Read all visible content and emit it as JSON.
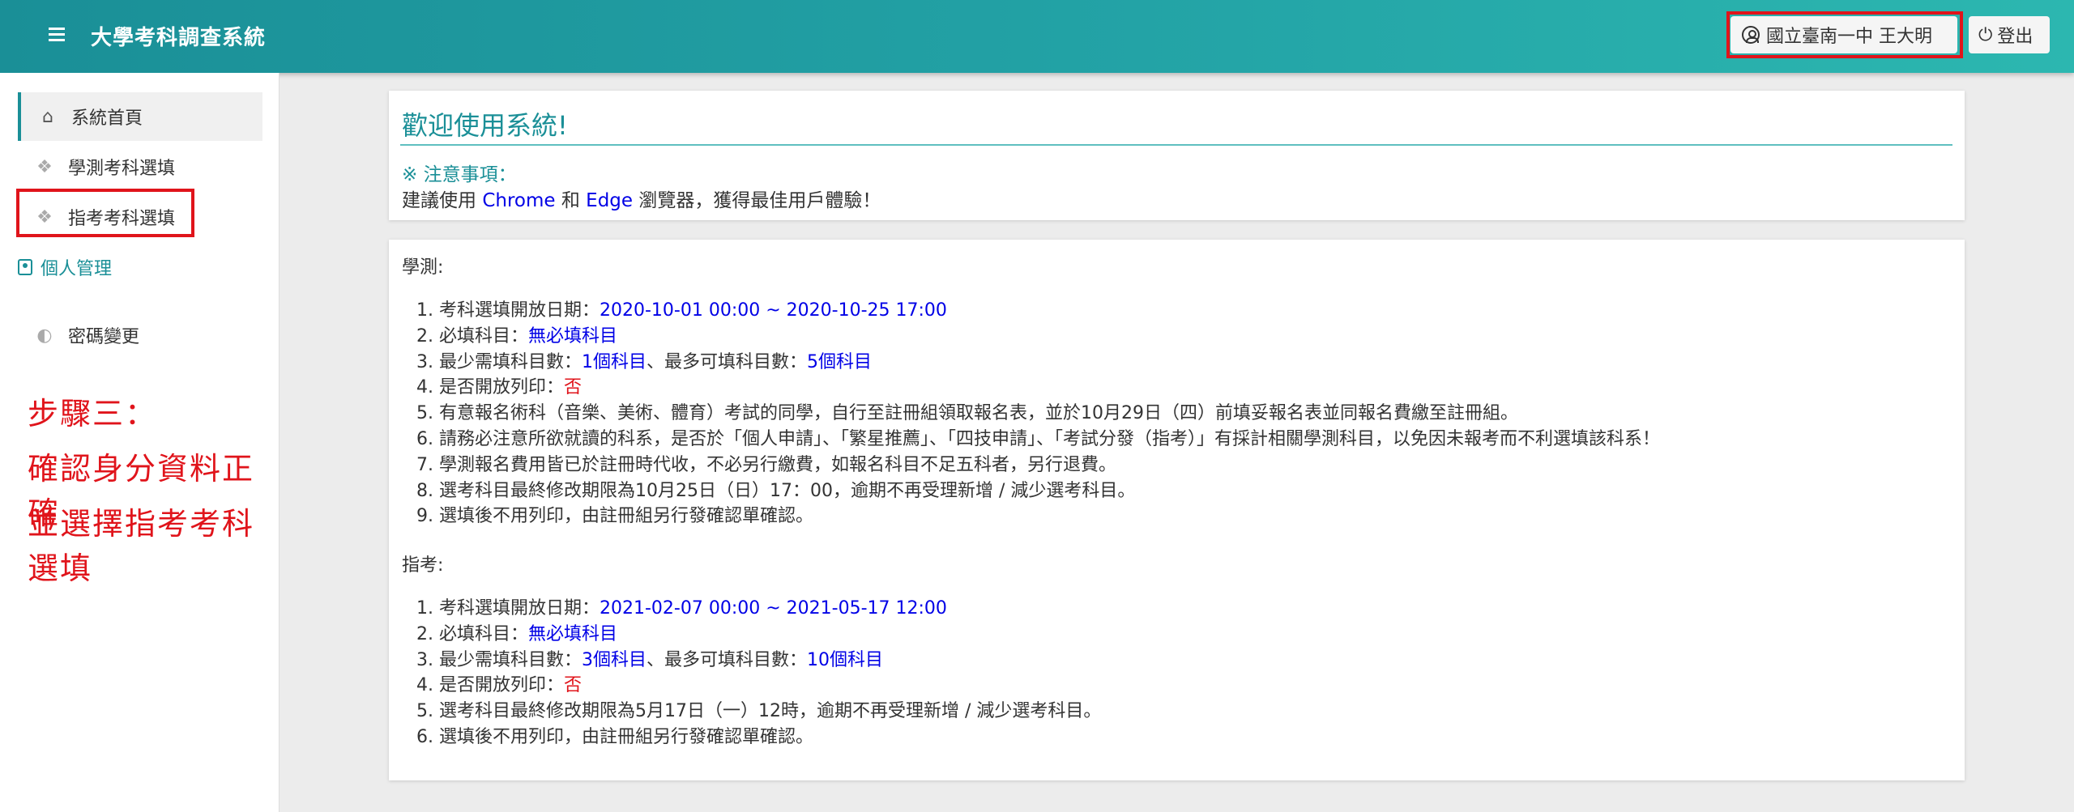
{
  "header": {
    "app_title": "大學考科調查系統",
    "user_label": "國立臺南一中 王大明",
    "logout_label": "登出"
  },
  "sidebar": {
    "items": [
      {
        "label": "系統首頁",
        "icon": "home-icon"
      },
      {
        "label": "學測考科選填",
        "icon": "cubes-icon"
      },
      {
        "label": "指考考科選填",
        "icon": "cubes-icon"
      }
    ],
    "section_label": "個人管理",
    "password_label": "密碼變更"
  },
  "annotation": {
    "line1": "步驟三：",
    "line2": "確認身分資料正確",
    "line3": "並選擇指考考科選填"
  },
  "welcome": {
    "title": "歡迎使用系統!",
    "notice_title": "※ 注意事項：",
    "notice_pre": "建議使用 ",
    "chrome": "Chrome",
    "and": " 和 ",
    "edge": "Edge",
    "notice_post": " 瀏覽器，獲得最佳用戶體驗！"
  },
  "xuece": {
    "label": "學測:",
    "items": [
      {
        "pre": "1. 考科選填開放日期：",
        "val": "2020-10-01 00:00 ~ 2020-10-25 17:00"
      },
      {
        "pre": "2. 必填科目：",
        "val": "無必填科目"
      },
      {
        "pre": "3. 最少需填科目數：",
        "val": "1個科目",
        "mid": "、最多可填科目數：",
        "val2": "5個科目"
      },
      {
        "pre": "4. 是否開放列印：",
        "val_red": "否"
      },
      {
        "pre": "5. 有意報名術科（音樂、美術、體育）考試的同學，自行至註冊組領取報名表，並於10月29日（四）前填妥報名表並同報名費繳至註冊組。"
      },
      {
        "pre": "6. 請務必注意所欲就讀的科系，是否於「個人申請」、「繁星推薦」、「四技申請」、「考試分發（指考）」有採計相關學測科目，以免因未報考而不利選填該科系！"
      },
      {
        "pre": "7. 學測報名費用皆已於註冊時代收，不必另行繳費，如報名科目不足五科者，另行退費。"
      },
      {
        "pre": "8. 選考科目最終修改期限為10月25日（日）17：00，逾期不再受理新增 / 減少選考科目。"
      },
      {
        "pre": "9. 選填後不用列印，由註冊組另行發確認單確認。"
      }
    ]
  },
  "zhikao": {
    "label": "指考:",
    "items": [
      {
        "pre": "1. 考科選填開放日期：",
        "val": "2021-02-07 00:00 ~ 2021-05-17 12:00"
      },
      {
        "pre": "2. 必填科目：",
        "val": "無必填科目"
      },
      {
        "pre": "3. 最少需填科目數：",
        "val": "3個科目",
        "mid": "、最多可填科目數：",
        "val2": "10個科目"
      },
      {
        "pre": "4. 是否開放列印：",
        "val_red": "否"
      },
      {
        "pre": "5. 選考科目最終修改期限為5月17日（一）12時，逾期不再受理新增 / 減少選考科目。"
      },
      {
        "pre": "6. 選填後不用列印，由註冊組另行發確認單確認。"
      }
    ]
  },
  "colors": {
    "accent": "#1a8f97",
    "link_blue": "#0000e6",
    "alert_red": "#e0141b"
  }
}
